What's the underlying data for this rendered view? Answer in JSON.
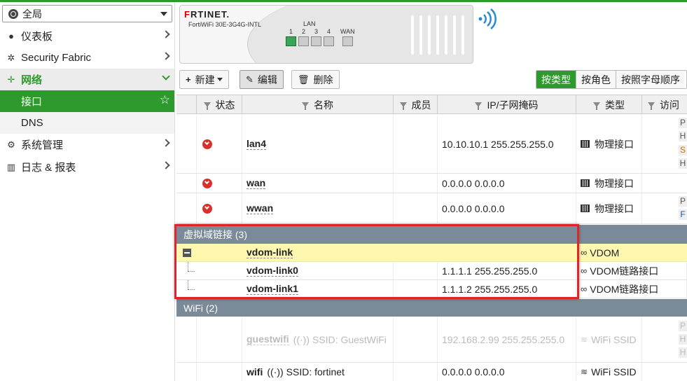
{
  "scope": {
    "label": "全局"
  },
  "sidebar": {
    "items": [
      {
        "label": "仪表板",
        "icon": "dashboard-icon"
      },
      {
        "label": "Security Fabric",
        "icon": "fabric-icon"
      },
      {
        "label": "网络",
        "icon": "network-icon"
      },
      {
        "label": "接口"
      },
      {
        "label": "DNS"
      },
      {
        "label": "系统管理",
        "icon": "gear-icon"
      },
      {
        "label": "日志 & 报表",
        "icon": "chart-icon"
      }
    ]
  },
  "device": {
    "brand_red": "F",
    "brand_rest": "RTINET.",
    "model": "FortiWiFi 30E-3G4G-INTL",
    "lan_label": "LAN",
    "ports": [
      "1",
      "2",
      "3",
      "4",
      "WAN"
    ]
  },
  "toolbar": {
    "new_label": "新建",
    "edit_label": "编辑",
    "delete_label": "删除",
    "views": [
      "按类型",
      "按角色",
      "按照字母顺序"
    ]
  },
  "table": {
    "headers": [
      "状态",
      "名称",
      "成员",
      "IP/子网掩码",
      "类型",
      "访问"
    ],
    "rows": [
      {
        "name": "lan4",
        "ip": "10.10.10.1 255.255.255.0",
        "type": "物理接口",
        "tags": [
          "P",
          "H",
          "S",
          "H"
        ]
      },
      {
        "name": "wan",
        "ip": "0.0.0.0 0.0.0.0",
        "type": "物理接口"
      },
      {
        "name": "wwan",
        "ip": "0.0.0.0 0.0.0.0",
        "type": "物理接口",
        "tags": [
          "P",
          "F"
        ]
      }
    ],
    "group_vdom": "虚拟域链接 (3)",
    "vdom_rows": [
      {
        "name": "vdom-link",
        "ip": "",
        "type": "VDOM"
      },
      {
        "name": "vdom-link0",
        "ip": "1.1.1.1 255.255.255.0",
        "type": "VDOM链路接口"
      },
      {
        "name": "vdom-link1",
        "ip": "1.1.1.2 255.255.255.0",
        "type": "VDOM链路接口"
      }
    ],
    "group_wifi": "WiFi (2)",
    "wifi_rows": [
      {
        "name": "guestwifi",
        "ssid": "SSID: GuestWiFi",
        "ip": "192.168.2.99 255.255.255.0",
        "type": "WiFi SSID",
        "tags": [
          "P",
          "H",
          "H"
        ]
      },
      {
        "name": "wifi",
        "ssid": "SSID: fortinet",
        "ip": "0.0.0.0 0.0.0.0",
        "type": "WiFi SSID"
      }
    ]
  },
  "colors": {
    "accent": "#2e9a2e",
    "group_bg": "#7b8a98",
    "vdom_highlight": "#fdf7b0",
    "annotation": "#e0242a",
    "status_down": "#d9302c"
  }
}
